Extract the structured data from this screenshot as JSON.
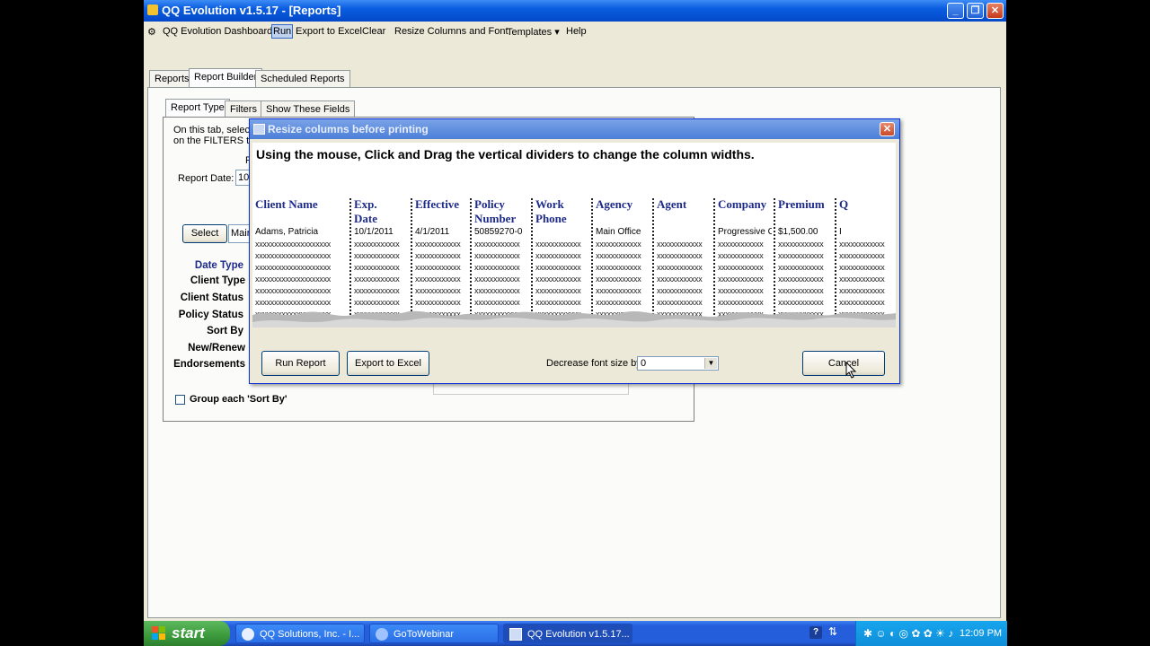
{
  "window": {
    "title": "QQ Evolution v1.5.17 - [Reports]",
    "menu": [
      "QQ Evolution Dashboard",
      "Run",
      "Export to Excel",
      "Clear",
      "Resize Columns and Font",
      "Templates ▾",
      "Help"
    ]
  },
  "tabs": {
    "top": [
      "Reports",
      "Report Builder",
      "Scheduled Reports"
    ],
    "inner": [
      "Report Type",
      "Filters",
      "Show These Fields"
    ]
  },
  "builder": {
    "intro1": "On this tab, select",
    "intro2": "on the FILTERS ta",
    "partial_f": "F",
    "report_date_label": "Report Date:",
    "report_date_value": "10",
    "select_button": "Select",
    "select_value": "Mair",
    "date_type": "Date Type",
    "client_type": "Client Type",
    "client_status": "Client Status",
    "policy_status": "Policy Status",
    "sort_by": "Sort By",
    "new_renew": "New/Renew",
    "endorsements": "Endorsements",
    "group_label": "Group each 'Sort By'"
  },
  "dialog": {
    "title": "Resize columns before printing",
    "instruction": "Using the mouse, Click and Drag the vertical dividers to change the column widths.",
    "columns": [
      {
        "h1": "Client Name",
        "h2": "",
        "v": "Adams, Patricia",
        "x": "xxxxxxxxxxxxxxxxxxxx"
      },
      {
        "h1": "Exp.",
        "h2": "Date",
        "v": "10/1/2011",
        "x": "xxxxxxxxxxxx"
      },
      {
        "h1": "Effective",
        "h2": "",
        "v": "4/1/2011",
        "x": "xxxxxxxxxxxx"
      },
      {
        "h1": "Policy",
        "h2": "Number",
        "v": "50859270-0",
        "x": "xxxxxxxxxxxx"
      },
      {
        "h1": "Work",
        "h2": "Phone",
        "v": "",
        "x": "xxxxxxxxxxxx"
      },
      {
        "h1": "Agency",
        "h2": "",
        "v": "Main Office",
        "x": "xxxxxxxxxxxx"
      },
      {
        "h1": "Agent",
        "h2": "",
        "v": "",
        "x": "xxxxxxxxxxxx"
      },
      {
        "h1": "Company",
        "h2": "",
        "v": "Progressive C",
        "x": "xxxxxxxxxxxx"
      },
      {
        "h1": "Premium",
        "h2": "",
        "v": "$1,500.00",
        "x": "xxxxxxxxxxxx"
      },
      {
        "h1": "Q",
        "h2": "",
        "v": "I",
        "x": "xxxxxxxxxxxx"
      }
    ],
    "run_report": "Run Report",
    "export_excel": "Export to Excel",
    "font_label": "Decrease font size by:",
    "font_value": "0",
    "cancel": "Cancel"
  },
  "taskbar": {
    "start": "start",
    "tasks": [
      "QQ Solutions, Inc. - I...",
      "GoToWebinar",
      "QQ Evolution v1.5.17..."
    ],
    "clock": "12:09 PM"
  }
}
